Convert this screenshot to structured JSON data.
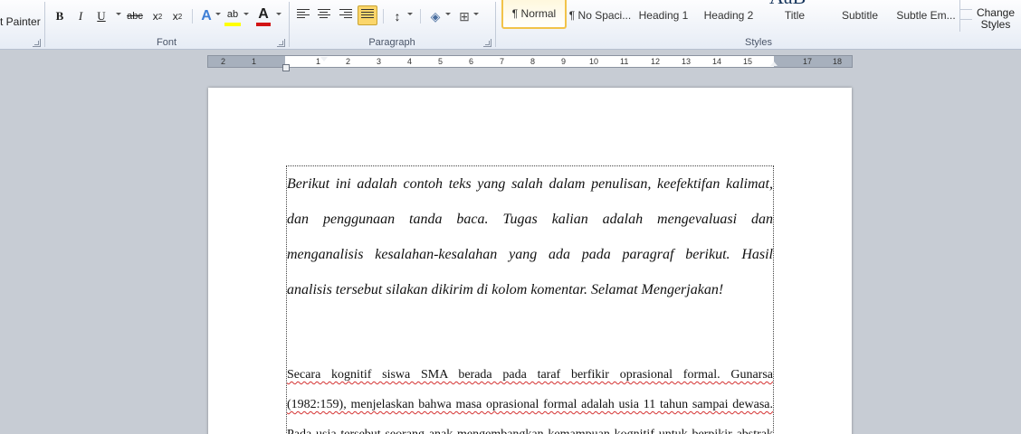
{
  "clipboard": {
    "format_painter_label": "t Painter"
  },
  "font_group": {
    "label": "Font",
    "bold": "B",
    "italic": "I",
    "underline": "U",
    "strike": "abc",
    "subscript": "x",
    "sub_mark": "2",
    "superscript": "x",
    "sup_mark": "2",
    "text_effects": "A",
    "highlight": "ab",
    "font_color": "A",
    "highlight_color": "#ffff00",
    "font_color_value": "#d21414"
  },
  "paragraph_group": {
    "label": "Paragraph",
    "active_alignment": "justify"
  },
  "styles_group": {
    "label": "Styles",
    "items": [
      {
        "name": "¶ Normal",
        "active": true
      },
      {
        "name": "¶ No Spaci..."
      },
      {
        "name": "Heading 1"
      },
      {
        "name": "Heading 2"
      },
      {
        "name": "Title"
      },
      {
        "name": "Subtitle"
      },
      {
        "name": "Subtle Em..."
      }
    ],
    "change_styles": "Change Styles"
  },
  "ruler": {
    "left_numbers": [
      "2",
      "1",
      "1"
    ],
    "numbers": [
      "2",
      "3",
      "4",
      "5",
      "6",
      "7",
      "8",
      "9",
      "10",
      "11",
      "12",
      "13",
      "14",
      "15"
    ],
    "right_numbers": [
      "17",
      "18"
    ]
  },
  "document": {
    "para1_lines": [
      "Berikut ini adalah contoh teks yang salah dalam penulisan, keefektifan kalimat,",
      "dan penggunaan tanda baca. Tugas kalian adalah mengevaluasi dan",
      "menganalisis kesalahan-kesalahan yang ada pada paragraf berikut. Hasil",
      "analisis tersebut silakan dikirim di kolom komentar. Selamat Mengerjakan!"
    ],
    "para2_lines": [
      "Secara kognitif siswa SMA berada pada taraf berfikir oprasional formal. Gunarsa",
      "(1982:159), menjelaskan bahwa masa oprasional formal adalah usia 11 tahun sampai dewasa.",
      "Pada usia tersebut seorang anak mengembangkan kemampuan kognitif untuk berpikir abstrak"
    ]
  },
  "colors": {
    "ribbon_accent": "#fbd66b",
    "page_bg": "#ffffff",
    "workspace_bg": "#c7ccd4"
  }
}
